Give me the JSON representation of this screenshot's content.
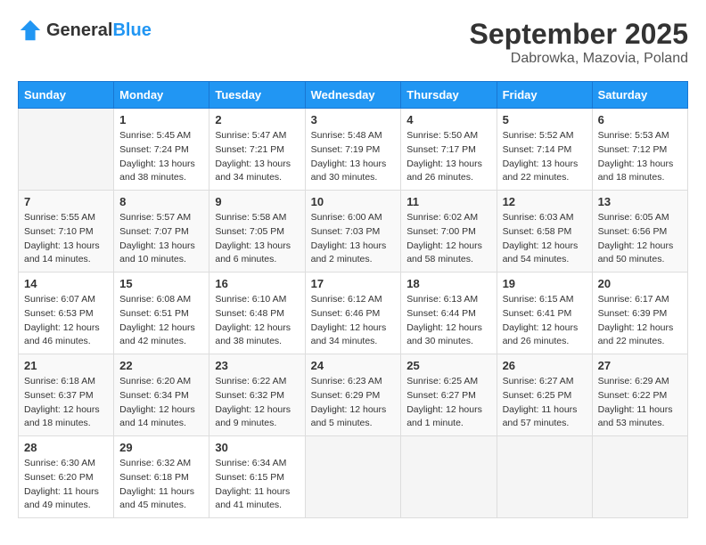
{
  "logo": {
    "general": "General",
    "blue": "Blue"
  },
  "header": {
    "month": "September 2025",
    "location": "Dabrowka, Mazovia, Poland"
  },
  "weekdays": [
    "Sunday",
    "Monday",
    "Tuesday",
    "Wednesday",
    "Thursday",
    "Friday",
    "Saturday"
  ],
  "weeks": [
    [
      {
        "day": "",
        "info": ""
      },
      {
        "day": "1",
        "info": "Sunrise: 5:45 AM\nSunset: 7:24 PM\nDaylight: 13 hours\nand 38 minutes."
      },
      {
        "day": "2",
        "info": "Sunrise: 5:47 AM\nSunset: 7:21 PM\nDaylight: 13 hours\nand 34 minutes."
      },
      {
        "day": "3",
        "info": "Sunrise: 5:48 AM\nSunset: 7:19 PM\nDaylight: 13 hours\nand 30 minutes."
      },
      {
        "day": "4",
        "info": "Sunrise: 5:50 AM\nSunset: 7:17 PM\nDaylight: 13 hours\nand 26 minutes."
      },
      {
        "day": "5",
        "info": "Sunrise: 5:52 AM\nSunset: 7:14 PM\nDaylight: 13 hours\nand 22 minutes."
      },
      {
        "day": "6",
        "info": "Sunrise: 5:53 AM\nSunset: 7:12 PM\nDaylight: 13 hours\nand 18 minutes."
      }
    ],
    [
      {
        "day": "7",
        "info": "Sunrise: 5:55 AM\nSunset: 7:10 PM\nDaylight: 13 hours\nand 14 minutes."
      },
      {
        "day": "8",
        "info": "Sunrise: 5:57 AM\nSunset: 7:07 PM\nDaylight: 13 hours\nand 10 minutes."
      },
      {
        "day": "9",
        "info": "Sunrise: 5:58 AM\nSunset: 7:05 PM\nDaylight: 13 hours\nand 6 minutes."
      },
      {
        "day": "10",
        "info": "Sunrise: 6:00 AM\nSunset: 7:03 PM\nDaylight: 13 hours\nand 2 minutes."
      },
      {
        "day": "11",
        "info": "Sunrise: 6:02 AM\nSunset: 7:00 PM\nDaylight: 12 hours\nand 58 minutes."
      },
      {
        "day": "12",
        "info": "Sunrise: 6:03 AM\nSunset: 6:58 PM\nDaylight: 12 hours\nand 54 minutes."
      },
      {
        "day": "13",
        "info": "Sunrise: 6:05 AM\nSunset: 6:56 PM\nDaylight: 12 hours\nand 50 minutes."
      }
    ],
    [
      {
        "day": "14",
        "info": "Sunrise: 6:07 AM\nSunset: 6:53 PM\nDaylight: 12 hours\nand 46 minutes."
      },
      {
        "day": "15",
        "info": "Sunrise: 6:08 AM\nSunset: 6:51 PM\nDaylight: 12 hours\nand 42 minutes."
      },
      {
        "day": "16",
        "info": "Sunrise: 6:10 AM\nSunset: 6:48 PM\nDaylight: 12 hours\nand 38 minutes."
      },
      {
        "day": "17",
        "info": "Sunrise: 6:12 AM\nSunset: 6:46 PM\nDaylight: 12 hours\nand 34 minutes."
      },
      {
        "day": "18",
        "info": "Sunrise: 6:13 AM\nSunset: 6:44 PM\nDaylight: 12 hours\nand 30 minutes."
      },
      {
        "day": "19",
        "info": "Sunrise: 6:15 AM\nSunset: 6:41 PM\nDaylight: 12 hours\nand 26 minutes."
      },
      {
        "day": "20",
        "info": "Sunrise: 6:17 AM\nSunset: 6:39 PM\nDaylight: 12 hours\nand 22 minutes."
      }
    ],
    [
      {
        "day": "21",
        "info": "Sunrise: 6:18 AM\nSunset: 6:37 PM\nDaylight: 12 hours\nand 18 minutes."
      },
      {
        "day": "22",
        "info": "Sunrise: 6:20 AM\nSunset: 6:34 PM\nDaylight: 12 hours\nand 14 minutes."
      },
      {
        "day": "23",
        "info": "Sunrise: 6:22 AM\nSunset: 6:32 PM\nDaylight: 12 hours\nand 9 minutes."
      },
      {
        "day": "24",
        "info": "Sunrise: 6:23 AM\nSunset: 6:29 PM\nDaylight: 12 hours\nand 5 minutes."
      },
      {
        "day": "25",
        "info": "Sunrise: 6:25 AM\nSunset: 6:27 PM\nDaylight: 12 hours\nand 1 minute."
      },
      {
        "day": "26",
        "info": "Sunrise: 6:27 AM\nSunset: 6:25 PM\nDaylight: 11 hours\nand 57 minutes."
      },
      {
        "day": "27",
        "info": "Sunrise: 6:29 AM\nSunset: 6:22 PM\nDaylight: 11 hours\nand 53 minutes."
      }
    ],
    [
      {
        "day": "28",
        "info": "Sunrise: 6:30 AM\nSunset: 6:20 PM\nDaylight: 11 hours\nand 49 minutes."
      },
      {
        "day": "29",
        "info": "Sunrise: 6:32 AM\nSunset: 6:18 PM\nDaylight: 11 hours\nand 45 minutes."
      },
      {
        "day": "30",
        "info": "Sunrise: 6:34 AM\nSunset: 6:15 PM\nDaylight: 11 hours\nand 41 minutes."
      },
      {
        "day": "",
        "info": ""
      },
      {
        "day": "",
        "info": ""
      },
      {
        "day": "",
        "info": ""
      },
      {
        "day": "",
        "info": ""
      }
    ]
  ]
}
